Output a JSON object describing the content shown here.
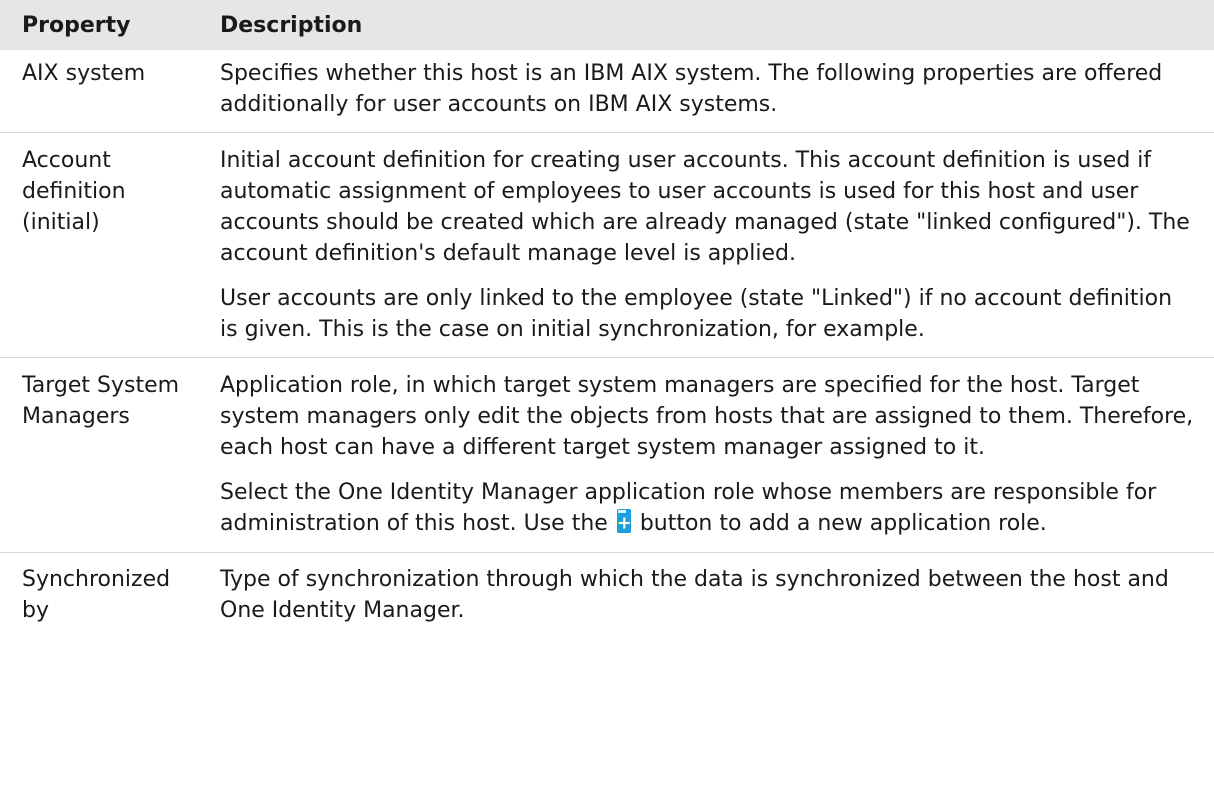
{
  "header": {
    "property": "Property",
    "description": "Description"
  },
  "rows": [
    {
      "property": "AIX system",
      "paragraphs": [
        "Specifies whether this host is an IBM AIX system. The following properties are offered additionally for user accounts on IBM AIX systems."
      ]
    },
    {
      "property": "Account definition (initial)",
      "paragraphs": [
        "Initial account definition for creating user accounts. This account definition is used if automatic assignment of employees to user accounts is used for this host and user accounts should be created which are already managed (state \"linked configured\"). The account definition's default manage level is applied.",
        "User accounts are only linked to the employee (state \"Linked\") if no account definition is given. This is the case on initial synchronization, for example."
      ]
    },
    {
      "property": "Target System Managers",
      "paragraphs": [
        "Application role, in which target system managers are specified for the host. Target system managers only edit the objects from hosts that are assigned to them. Therefore, each host can have a different target system manager assigned to it."
      ],
      "last_paragraph": {
        "before_icon": "Select the One Identity Manager application role whose members are responsible for administration of this host. Use the",
        "icon": "add-new-icon",
        "after_icon": "button to add a new application role."
      }
    },
    {
      "property": "Synchronized by",
      "paragraphs": [
        "Type of synchronization through which the data is synchronized between the host and One Identity Manager."
      ]
    }
  ],
  "colors": {
    "header_bg": "#e6e6e6",
    "text": "#1a1a1a",
    "row_border": "#d8d8d8",
    "icon_blue": "#1b9fe0",
    "icon_green": "#5cb83a"
  }
}
